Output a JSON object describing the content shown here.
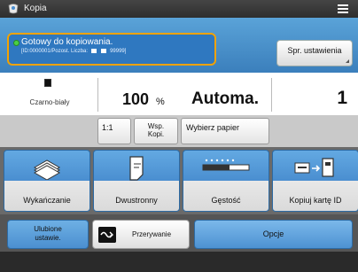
{
  "titlebar": {
    "title": "Kopia",
    "icon": "copy-app-icon",
    "menu_icon": "hamburger-menu-icon"
  },
  "status": {
    "message": "Gotowy do kopiowania.",
    "detail": "[ID:0000001/Pozost. Liczba:",
    "detail_end": "99999]",
    "indicator_color": "#4ad046",
    "highlight_color": "#f3a200"
  },
  "settings_button": {
    "label": "Spr. ustawienia"
  },
  "info": {
    "color_mode": "Czarno-biały",
    "zoom": "100",
    "zoom_unit": "%",
    "paper": "Automa.",
    "copies": "1"
  },
  "mid_buttons": {
    "ratio": "1:1",
    "wsp_line1": "Wsp.",
    "wsp_line2": "Kopi.",
    "paper_select": "Wybierz papier"
  },
  "functions": [
    {
      "label": "Wykańczanie",
      "icon": "finishing-icon"
    },
    {
      "label": "Dwustronny",
      "icon": "two-sided-icon"
    },
    {
      "label": "Gęstość",
      "icon": "density-icon"
    },
    {
      "label": "Kopiuj kartę ID",
      "icon": "id-card-copy-icon"
    }
  ],
  "bottom": {
    "favorites_line1": "Ulubione",
    "favorites_line2": "ustawie.",
    "interrupt": "Przerywanie",
    "options": "Opcje"
  },
  "colors": {
    "accent_blue": "#4a8ed0",
    "status_bg": "#3b7fbc"
  }
}
